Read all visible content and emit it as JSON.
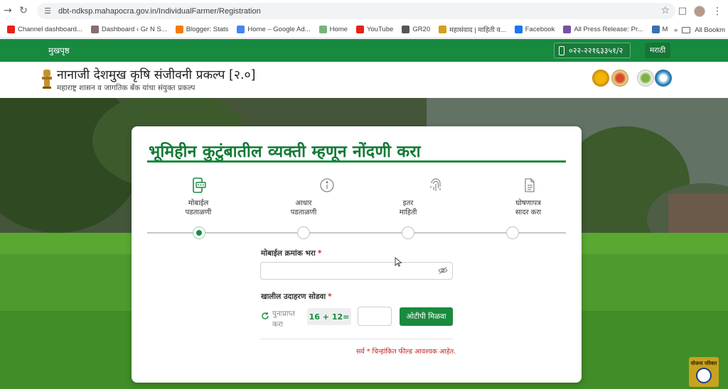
{
  "browser": {
    "url": "dbt-ndksp.mahapocra.gov.in/IndividualFarmer/Registration",
    "bookmarks": [
      {
        "label": "Channel dashboard...",
        "icon": "youtube-icon",
        "color": "#e62117"
      },
      {
        "label": "Dashboard ‹ Gr N S...",
        "icon": "wordpress-icon",
        "color": "#8a6d6d"
      },
      {
        "label": "Blogger: Stats",
        "icon": "blogger-icon",
        "color": "#f57d00"
      },
      {
        "label": "Home – Google Ad...",
        "icon": "google-ads-icon",
        "color": "#4285f4"
      },
      {
        "label": "Home",
        "icon": "leaf-icon",
        "color": "#7ab37a"
      },
      {
        "label": "YouTube",
        "icon": "youtube-icon",
        "color": "#e62117"
      },
      {
        "label": "GR20",
        "icon": "globe-icon",
        "color": "#555555"
      },
      {
        "label": "महासंवाद | माहिती व...",
        "icon": "emblem-icon",
        "color": "#d4a017"
      },
      {
        "label": "Facebook",
        "icon": "facebook-icon",
        "color": "#1877f2"
      },
      {
        "label": "All Press Release: Pr...",
        "icon": "press-icon",
        "color": "#7a4fa0"
      },
      {
        "label": "MEDA",
        "icon": "meda-icon",
        "color": "#3b6fb6"
      }
    ],
    "all_bookmarks": "All Bookm"
  },
  "header": {
    "home": "मुखपृष्ठ",
    "phone": "०२२-२२१६३३५१/२",
    "language": "मराठी",
    "title": "नानाजी देशमुख कृषि संजीवनी प्रकल्प [२.०]",
    "subtitle": "महाराष्ट्र शासन व जागतिक बँक यांचा संयुक्त प्रकल्प"
  },
  "form": {
    "title": "भूमिहीन कुटुंबातील व्यक्ती म्हणून नोंदणी करा",
    "steps": [
      {
        "line1": "मोबाईल",
        "line2": "पडताळणी",
        "icon": "mobile-verify-icon",
        "active": true
      },
      {
        "line1": "आधार",
        "line2": "पडताळणी",
        "icon": "fingerprint-icon",
        "active": false
      },
      {
        "line1": "इतर",
        "line2": "माहिती",
        "icon": "info-icon",
        "active": false
      },
      {
        "line1": "घोषणापत्र",
        "line2": "सादर करा",
        "icon": "document-icon",
        "active": false
      }
    ],
    "mobile_label": "मोबाईल क्रमांक भरा",
    "mobile_value": "",
    "captcha_label": "खालील उदाहरण सोडवा",
    "refresh_line1": "पुनःप्राप्त",
    "refresh_line2": "करा",
    "captcha_text": "16 + 12=",
    "captcha_value": "",
    "otp_button": "ओटीपी मिळवा",
    "required_note": "सर्व * चिन्हांकित फील्ड आवश्यक आहेत.",
    "required_mark": "*"
  },
  "watermark": {
    "text": "योजना परिवार"
  },
  "colors": {
    "brand_green": "#188a3f",
    "title_green": "#147a36",
    "required_red": "#c21f1f"
  }
}
